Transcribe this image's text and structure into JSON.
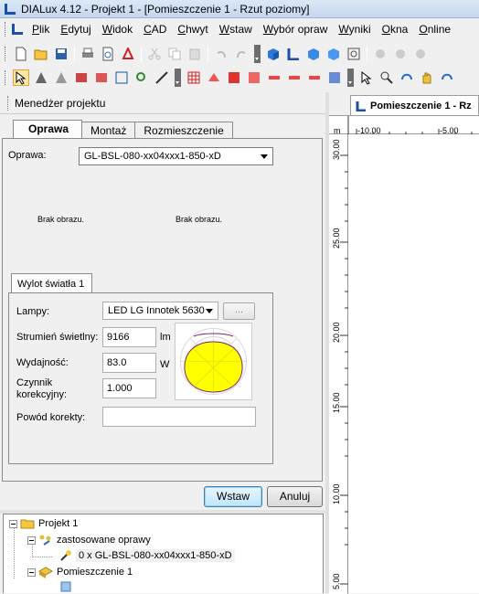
{
  "window": {
    "title": "DIALux 4.12 - Projekt 1 - [Pomieszczenie 1 - Rzut poziomy]"
  },
  "menu": [
    {
      "label": "Plik",
      "key": "P",
      "rest": "lik"
    },
    {
      "label": "Edytuj",
      "key": "E",
      "rest": "dytuj"
    },
    {
      "label": "Widok",
      "key": "W",
      "rest": "idok"
    },
    {
      "label": "CAD",
      "key": "C",
      "rest": "AD"
    },
    {
      "label": "Chwyt",
      "key": "C",
      "rest": "hwyt"
    },
    {
      "label": "Wstaw",
      "key": "W",
      "rest": "staw"
    },
    {
      "label": "Wybór opraw",
      "key": "W",
      "rest": "ybór opraw"
    },
    {
      "label": "Wyniki",
      "key": "W",
      "rest": "yniki"
    },
    {
      "label": "Okna",
      "key": "O",
      "rest": "kna"
    },
    {
      "label": "Online",
      "key": "O",
      "rest": "nline"
    }
  ],
  "project_manager": {
    "title": "Menedżer projektu",
    "tabs": [
      "Oprawa",
      "Montaż",
      "Rozmieszczenie"
    ],
    "oprawa_label": "Oprawa:",
    "oprawa_value": "GL-BSL-080-xx04xxx1-850-xD",
    "no_image_1": "Brak obrazu.",
    "no_image_2": "Brak obrazu.",
    "subtab": "Wylot światła 1",
    "lamps_label": "Lampy:",
    "lamps_value": "LED LG Innotek 5630",
    "dots_button": "...",
    "flux_label": "Strumień świetlny:",
    "flux_value": "9166",
    "flux_unit": "lm",
    "power_label": "Wydajność:",
    "power_value": "83.0",
    "power_unit": "W",
    "correction_label_1": "Czynnik",
    "correction_label_2": "korekcyjny:",
    "correction_value": "1.000",
    "reason_label": "Powód korekty:",
    "reason_value": "",
    "insert_button": "Wstaw",
    "cancel_button": "Anuluj"
  },
  "tree": {
    "project": "Projekt 1",
    "used_luminaires": "zastosowane oprawy",
    "luminaire_item": "0 x GL-BSL-080-xx04xxx1-850-xD",
    "room": "Pomieszczenie 1"
  },
  "view": {
    "tab_title": "Pomieszczenie 1 - Rz",
    "unit": "m",
    "x_ticks": [
      "-10.00",
      "-5.00"
    ],
    "y_ticks": [
      "30.00",
      "25.00",
      "20.00",
      "15.00",
      "10.00",
      "5.00"
    ]
  },
  "colors": {
    "accent": "#1c4fa8",
    "selection": "#fbe7a6",
    "polar_fill": "#ffff00"
  }
}
